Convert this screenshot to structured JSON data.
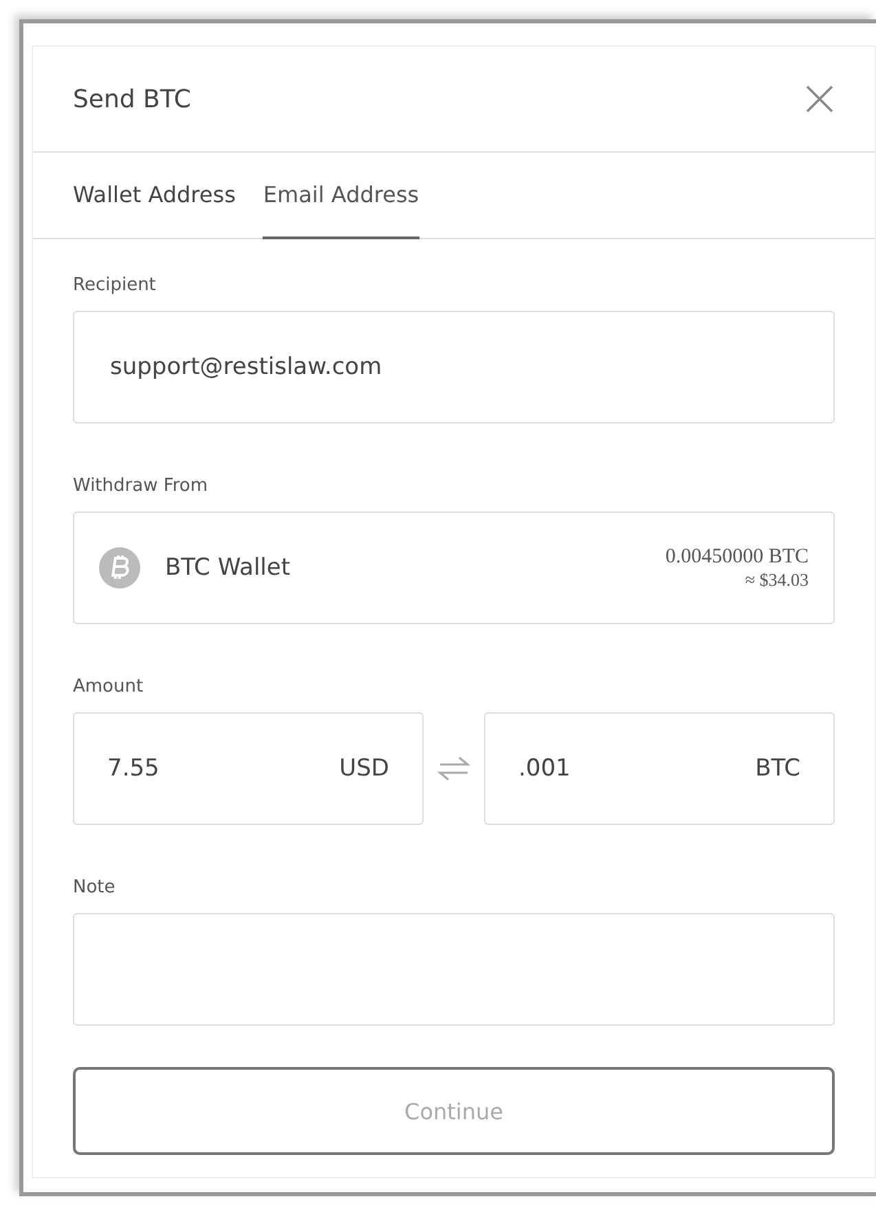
{
  "dialog": {
    "title": "Send BTC"
  },
  "tabs": [
    {
      "label": "Wallet Address",
      "selected": false
    },
    {
      "label": "Email Address",
      "selected": true
    }
  ],
  "recipient": {
    "label": "Recipient",
    "value": "support@restislaw.com"
  },
  "withdraw_from": {
    "label": "Withdraw From",
    "wallet": "BTC Wallet",
    "balance": "0.00450000 BTC",
    "balance_usd": "≈ $34.03"
  },
  "amount": {
    "label": "Amount",
    "fiat_value": "7.55",
    "fiat_currency": "USD",
    "crypto_value": ".001",
    "crypto_currency": "BTC"
  },
  "note": {
    "label": "Note"
  },
  "continue_button": {
    "label": "Continue",
    "disabled": true
  }
}
